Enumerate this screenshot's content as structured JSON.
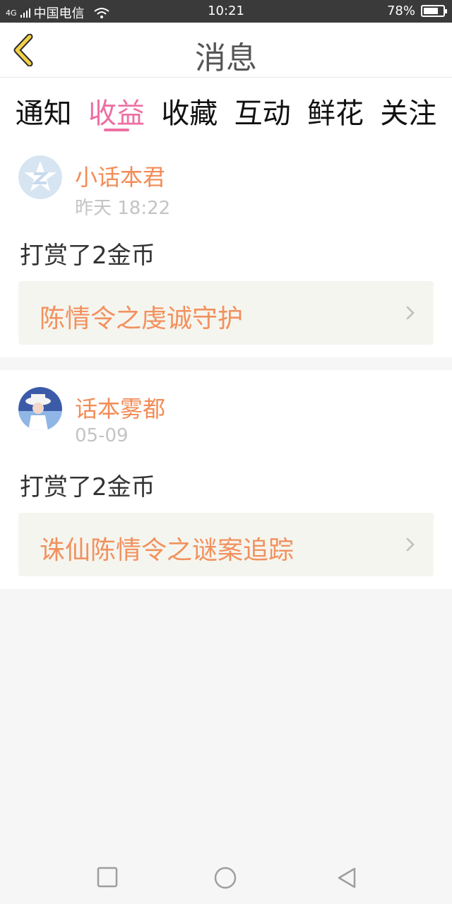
{
  "status": {
    "network": "4G",
    "carrier": "中国电信",
    "time": "10:21",
    "battery_text": "78%",
    "battery_level": 0.78
  },
  "header": {
    "title": "消息",
    "back_icon": "chevron-left-icon",
    "accent": "#f2d04a"
  },
  "tabs": [
    {
      "label": "通知",
      "active": false
    },
    {
      "label": "收益",
      "active": true
    },
    {
      "label": "收藏",
      "active": false
    },
    {
      "label": "互动",
      "active": false
    },
    {
      "label": "鲜花",
      "active": false
    },
    {
      "label": "关注",
      "active": false
    }
  ],
  "messages": [
    {
      "sender": "小话本君",
      "time": "昨天 18:22",
      "action": "打赏了2金币",
      "link_text": "陈情令之虔诚守护",
      "avatar_icon": "z-logo-avatar"
    },
    {
      "sender": "话本雾都",
      "time": "05-09",
      "action": "打赏了2金币",
      "link_text": "诛仙陈情令之谜案追踪",
      "avatar_icon": "user-photo-avatar"
    }
  ],
  "colors": {
    "active_tab": "#ee6fa2",
    "sender": "#f28c57",
    "link": "#f2915e"
  }
}
